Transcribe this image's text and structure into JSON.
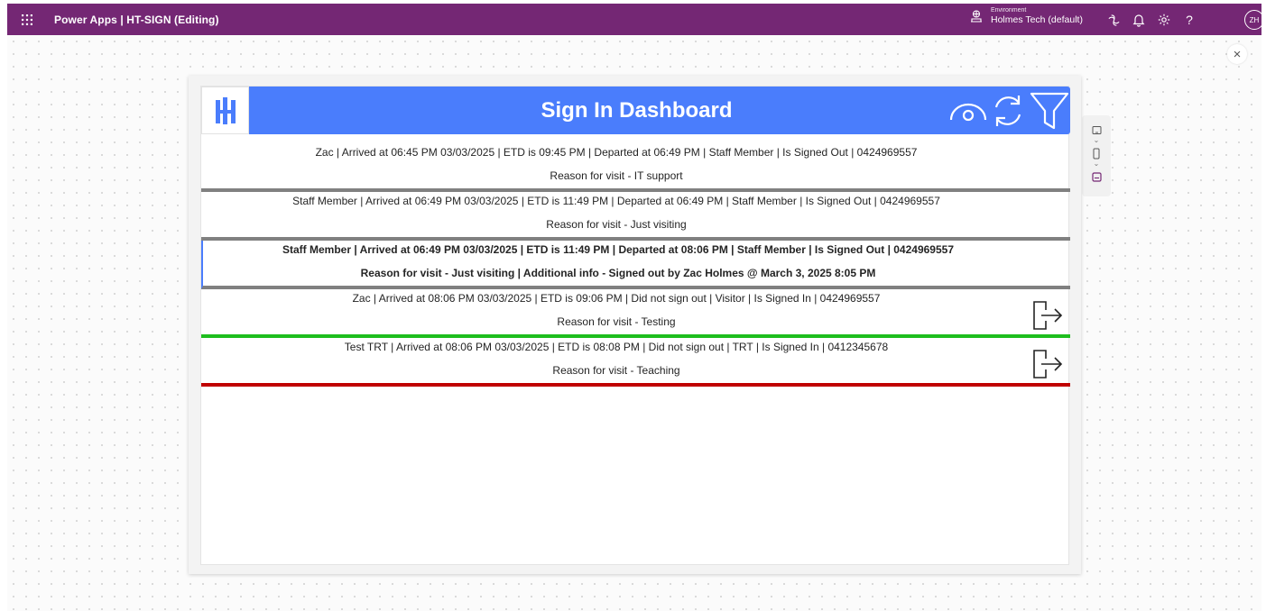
{
  "topbar": {
    "app_title": "Power Apps | HT-SIGN (Editing)",
    "environment_caption": "Environment",
    "environment_name": "Holmes Tech (default)",
    "avatar_initials": "ZH",
    "icons": [
      "waffle-icon",
      "environment-icon",
      "copilot-icon",
      "bell-icon",
      "settings-icon",
      "help-icon"
    ]
  },
  "canvas": {
    "close_glyph": "×"
  },
  "app": {
    "header_title": "Sign In Dashboard",
    "logo_text": "H",
    "header_icons": [
      "view-icon",
      "refresh-icon",
      "filter-icon"
    ],
    "header_color": "#4a7dfc"
  },
  "gallery": {
    "rows": [
      {
        "line1": "Zac | Arrived at 06:45 PM 03/03/2025 | ETD is 09:45 PM | Departed at 06:49 PM | Staff Member | Is Signed Out | 0424969557",
        "line2": "Reason for visit - IT support",
        "status_color": "#808080",
        "signout_button": false
      },
      {
        "line1": "Staff Member | Arrived at 06:49 PM 03/03/2025 | ETD is 11:49 PM | Departed at 06:49 PM | Staff Member | Is Signed Out | 0424969557",
        "line2": "Reason for visit - Just visiting",
        "status_color": "#808080",
        "signout_button": false
      },
      {
        "line1": "Staff Member | Arrived at 06:49 PM 03/03/2025 | ETD is 11:49 PM | Departed at 08:06 PM | Staff Member | Is Signed Out | 0424969557",
        "line2": "Reason for visit - Just visiting | Additional info - Signed out by Zac Holmes @ March 3, 2025 8:05 PM",
        "status_color": "#808080",
        "selected": true,
        "signout_button": false
      },
      {
        "line1": "Zac | Arrived at 08:06 PM 03/03/2025 | ETD is 09:06 PM | Did not sign out | Visitor | Is Signed In | 0424969557",
        "line2": "Reason for visit - Testing",
        "status_color": "#1ebe1e",
        "signout_button": true
      },
      {
        "line1": "Test TRT | Arrived at 08:06 PM 03/03/2025 | ETD is 08:08 PM | Did not sign out | TRT | Is Signed In | 0412345678",
        "line2": "Reason for visit - Teaching",
        "status_color": "#c00000",
        "signout_button": true
      }
    ]
  }
}
